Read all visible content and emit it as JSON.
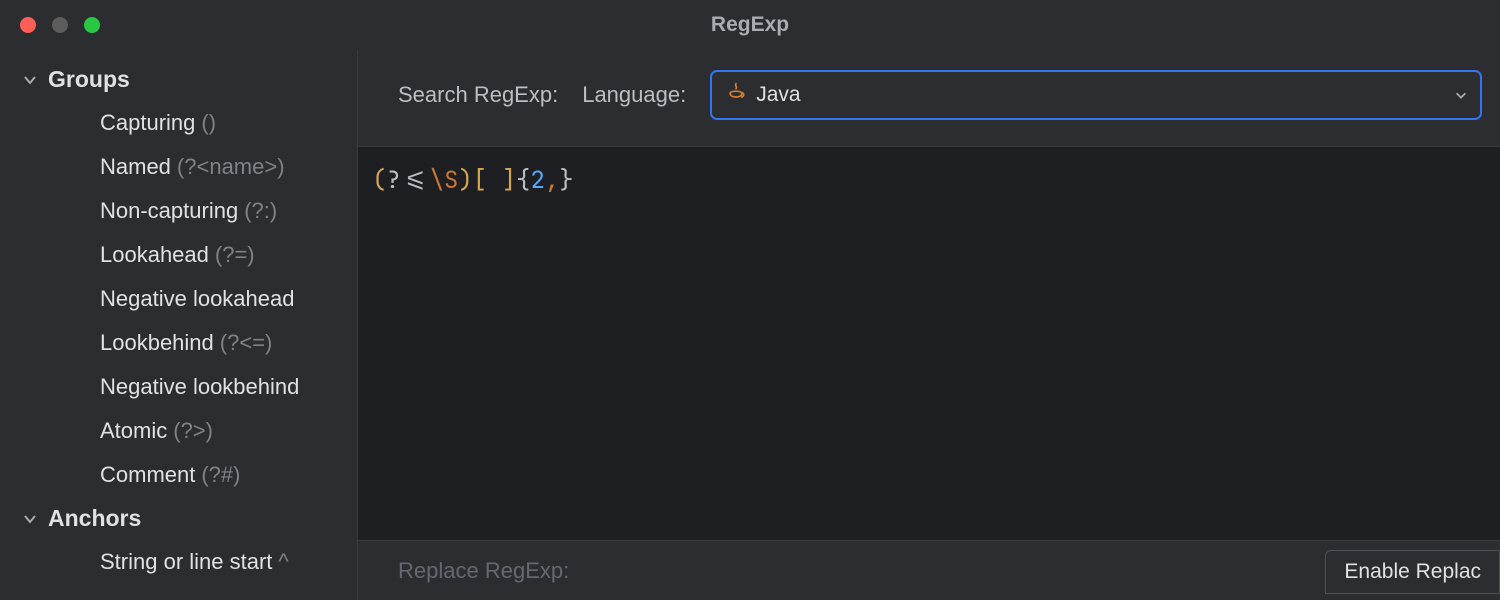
{
  "window": {
    "title": "RegExp"
  },
  "traffic": {
    "close": "#ff5f57",
    "min": "#5d5d5d",
    "max": "#28c840"
  },
  "sidebar": {
    "sections": [
      {
        "title": "Groups",
        "expanded": true,
        "items": [
          {
            "label": "Capturing",
            "hint": "()"
          },
          {
            "label": "Named",
            "hint": "(?<name>)"
          },
          {
            "label": "Non-capturing",
            "hint": "(?:)"
          },
          {
            "label": "Lookahead",
            "hint": "(?=)"
          },
          {
            "label": "Negative lookahead",
            "hint": ""
          },
          {
            "label": "Lookbehind",
            "hint": "(?<=)"
          },
          {
            "label": "Negative lookbehind",
            "hint": ""
          },
          {
            "label": "Atomic",
            "hint": "(?>)"
          },
          {
            "label": "Comment",
            "hint": "(?#)"
          }
        ]
      },
      {
        "title": "Anchors",
        "expanded": true,
        "items": [
          {
            "label": "String or line start",
            "hint": "^"
          }
        ]
      }
    ]
  },
  "toolbar": {
    "search_label": "Search RegExp:",
    "language_label": "Language:",
    "language_value": "Java"
  },
  "editor": {
    "tokens": [
      {
        "t": "(",
        "c": "paren"
      },
      {
        "t": "?<=",
        "c": "plain"
      },
      {
        "t": "\\S",
        "c": "esc"
      },
      {
        "t": ")",
        "c": "paren"
      },
      {
        "t": "[",
        "c": "paren"
      },
      {
        "t": " ",
        "c": "plain"
      },
      {
        "t": "]",
        "c": "paren"
      },
      {
        "t": "{",
        "c": "brace"
      },
      {
        "t": "2",
        "c": "num"
      },
      {
        "t": ",",
        "c": "comma"
      },
      {
        "t": "}",
        "c": "brace"
      }
    ]
  },
  "footer": {
    "replace_label": "Replace RegExp:",
    "enable_replace_label": "Enable Replac"
  }
}
